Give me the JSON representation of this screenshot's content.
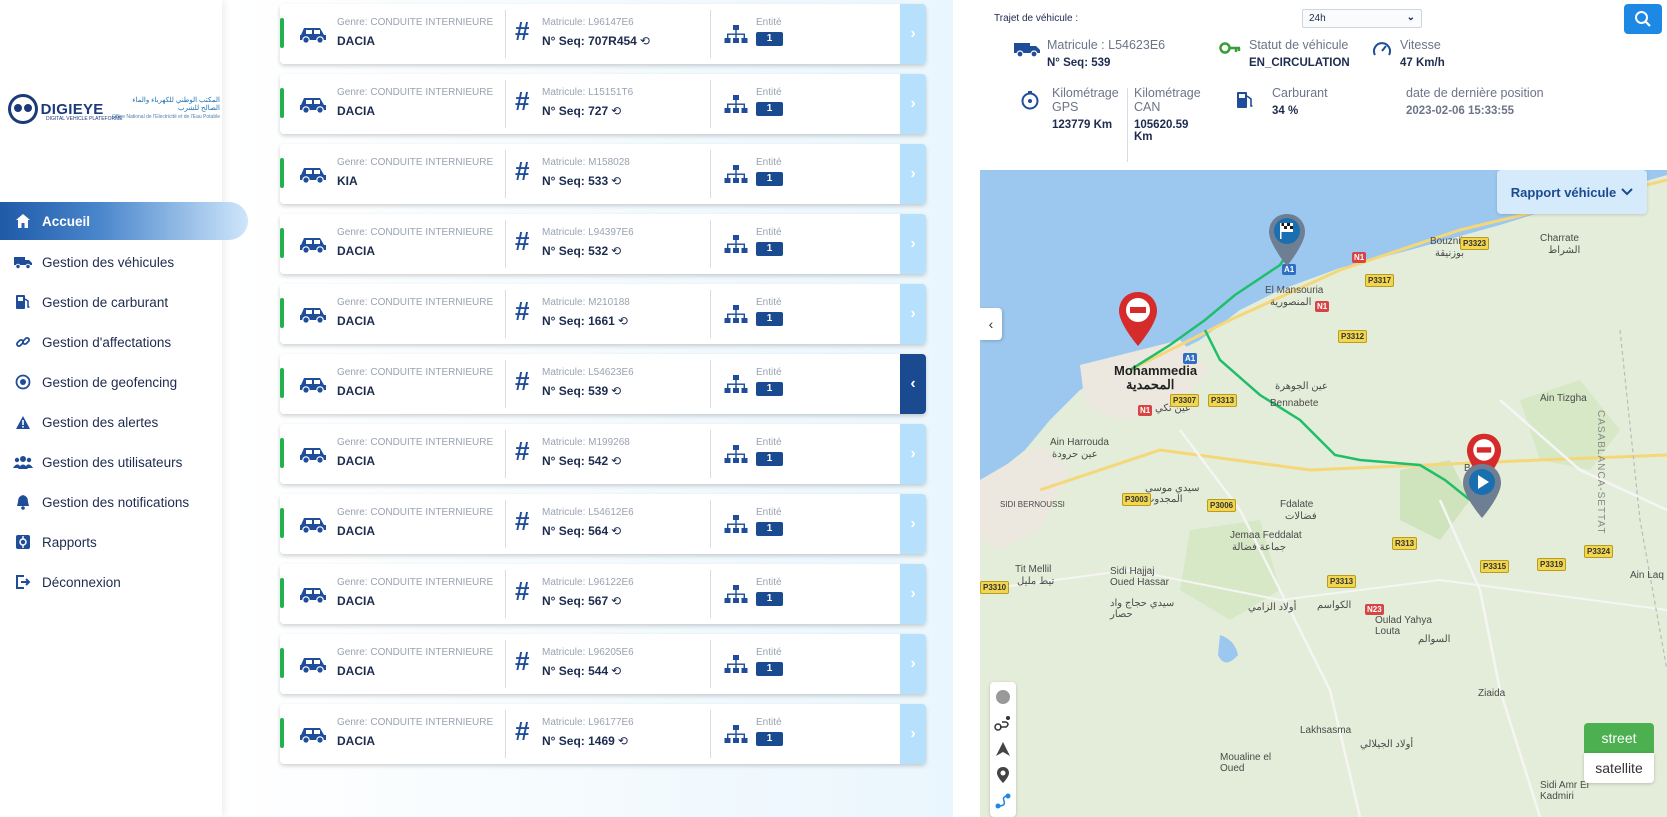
{
  "brand": {
    "name": "DIGIEYE",
    "subtitle": "DIGITAL VEHICLE PLATEFORME",
    "partner_ar": "المكتب الوطني للكهرباء والماء الصالح للشرب",
    "partner_fr": "Office National de l'Electricité et de l'Eau Potable"
  },
  "sidebar": {
    "items": [
      {
        "label": "Accueil",
        "icon": "home-icon",
        "active": true
      },
      {
        "label": "Gestion des véhicules",
        "icon": "truck-icon"
      },
      {
        "label": "Gestion de carburant",
        "icon": "fuel-pump-icon"
      },
      {
        "label": "Gestion d'affectations",
        "icon": "link-icon"
      },
      {
        "label": "Gestion de geofencing",
        "icon": "target-icon"
      },
      {
        "label": "Gestion des alertes",
        "icon": "warning-icon"
      },
      {
        "label": "Gestion des utilisateurs",
        "icon": "users-icon"
      },
      {
        "label": "Gestion des notifications",
        "icon": "bell-icon"
      },
      {
        "label": "Rapports",
        "icon": "report-icon"
      },
      {
        "label": "Déconnexion",
        "icon": "logout-icon"
      }
    ]
  },
  "vehicles": [
    {
      "genre": "Genre: CONDUITE INTERNIEURE",
      "brand": "DACIA",
      "matricule": "Matricule: L96147E6",
      "seq": "N° Seq: 707R454",
      "entite_label": "Entité",
      "entite": "1"
    },
    {
      "genre": "Genre: CONDUITE INTERNIEURE",
      "brand": "DACIA",
      "matricule": "Matricule: L15151T6",
      "seq": "N° Seq: 727",
      "entite_label": "Entité",
      "entite": "1"
    },
    {
      "genre": "Genre: CONDUITE INTERNIEURE",
      "brand": "KIA",
      "matricule": "Matricule: M158028",
      "seq": "N° Seq: 533",
      "entite_label": "Entité",
      "entite": "1"
    },
    {
      "genre": "Genre: CONDUITE INTERNIEURE",
      "brand": "DACIA",
      "matricule": "Matricule: L94397E6",
      "seq": "N° Seq: 532",
      "entite_label": "Entité",
      "entite": "1"
    },
    {
      "genre": "Genre: CONDUITE INTERNIEURE",
      "brand": "DACIA",
      "matricule": "Matricule: M210188",
      "seq": "N° Seq: 1661",
      "entite_label": "Entité",
      "entite": "1"
    },
    {
      "genre": "Genre: CONDUITE INTERNIEURE",
      "brand": "DACIA",
      "matricule": "Matricule: L54623E6",
      "seq": "N° Seq: 539",
      "entite_label": "Entité",
      "entite": "1",
      "selected": true
    },
    {
      "genre": "Genre: CONDUITE INTERNIEURE",
      "brand": "DACIA",
      "matricule": "Matricule: M199268",
      "seq": "N° Seq: 542",
      "entite_label": "Entité",
      "entite": "1"
    },
    {
      "genre": "Genre: CONDUITE INTERNIEURE",
      "brand": "DACIA",
      "matricule": "Matricule: L54612E6",
      "seq": "N° Seq: 564",
      "entite_label": "Entité",
      "entite": "1"
    },
    {
      "genre": "Genre: CONDUITE INTERNIEURE",
      "brand": "DACIA",
      "matricule": "Matricule: L96122E6",
      "seq": "N° Seq: 567",
      "entite_label": "Entité",
      "entite": "1"
    },
    {
      "genre": "Genre: CONDUITE INTERNIEURE",
      "brand": "DACIA",
      "matricule": "Matricule: L96205E6",
      "seq": "N° Seq: 544",
      "entite_label": "Entité",
      "entite": "1"
    },
    {
      "genre": "Genre: CONDUITE INTERNIEURE",
      "brand": "DACIA",
      "matricule": "Matricule: L96177E6",
      "seq": "N° Seq: 1469",
      "entite_label": "Entité",
      "entite": "1"
    }
  ],
  "detail": {
    "trajet_label": "Trajet de véhicule :",
    "trajet_value": "24h",
    "matricule": "Matricule : L54623E6",
    "seq": "N° Seq: 539",
    "statut_label": "Statut de véhicule",
    "statut_value": "EN_CIRCULATION",
    "vitesse_label": "Vitesse",
    "vitesse_value": "47 Km/h",
    "km_gps_label": "Kilométrage GPS",
    "km_gps_value": "123779 Km",
    "km_can_label": "Kilométrage CAN",
    "km_can_value": "105620.59 Km",
    "carburant_label": "Carburant",
    "carburant_value": "34 %",
    "date_label": "date de dernière position",
    "date_value": "2023-02-06 15:33:55"
  },
  "map": {
    "rapport_label": "Rapport véhicule",
    "layer_street": "street",
    "layer_satellite": "satellite",
    "places": [
      {
        "name": "Mohammedia",
        "cls": "big"
      },
      {
        "name": "المحمدية",
        "cls": "big"
      },
      {
        "name": "El Mansouria"
      },
      {
        "name": "المنصورية"
      },
      {
        "name": "Bouznika"
      },
      {
        "name": "بوزنيقة"
      },
      {
        "name": "Charrate"
      },
      {
        "name": "الشراط"
      },
      {
        "name": "Ain Harrouda"
      },
      {
        "name": "عين حرودة"
      },
      {
        "name": "Bennabete"
      },
      {
        "name": "عين الجوهرة"
      },
      {
        "name": "عين تكي"
      },
      {
        "name": "Fdalate"
      },
      {
        "name": "فضالات"
      },
      {
        "name": "Jemaa Feddalat"
      },
      {
        "name": "جماعة فضالة"
      },
      {
        "name": "سيدي موسى المجدوب"
      },
      {
        "name": "Tit Mellil"
      },
      {
        "name": "تيط مليل"
      },
      {
        "name": "Sidi Hajjaj Oued Hassar"
      },
      {
        "name": "سيدي حجاج واد حصار"
      },
      {
        "name": "أولاد الزامي"
      },
      {
        "name": "Oulad Yahya Louta"
      },
      {
        "name": "Ain Tizgha"
      },
      {
        "name": "Ben Sl"
      },
      {
        "name": "Lakhsasma"
      },
      {
        "name": "Moualine el Oued"
      },
      {
        "name": "Ziaida"
      },
      {
        "name": "Sidi Amr El Kadmiri"
      },
      {
        "name": "Ain Laq"
      },
      {
        "name": "SIDI BERNOUSSI"
      },
      {
        "name": "CASABLANCA-SETTAT"
      },
      {
        "name": "الكواسم"
      },
      {
        "name": "السوالم"
      },
      {
        "name": "أولاد الجيلالي"
      }
    ]
  },
  "colors": {
    "primary": "#1a4a8f",
    "accent_blue": "#1e88e5",
    "status_green": "#22b14c",
    "route": "#1fbf6a"
  }
}
